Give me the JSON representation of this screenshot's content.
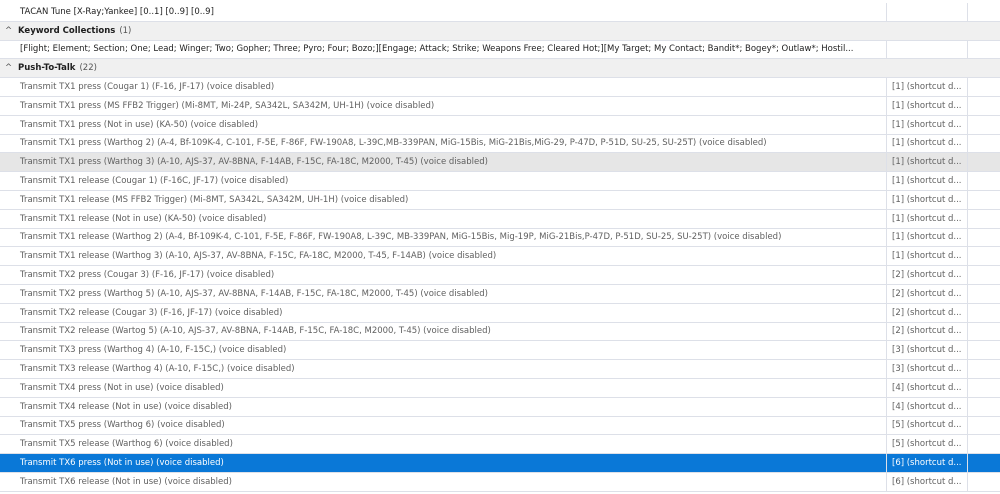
{
  "rows_top": [
    {
      "name": "TACAN Tune [X-Ray;Yankee] [0..1] [0..9] [0..9]",
      "arg": ""
    }
  ],
  "keyword_group": {
    "label": "Keyword Collections",
    "count": "(1)",
    "caret": "^"
  },
  "keyword_rows": [
    {
      "name": "[Flight; Element; Section; One; Lead; Winger; Two; Gopher; Three; Pyro; Four; Bozo;][Engage; Attack; Strike; Weapons Free; Cleared Hot;][My Target; My Contact; Bandit*; Bogey*; Outlaw*; Hostil...",
      "arg": ""
    }
  ],
  "ptt_group": {
    "label": "Push-To-Talk",
    "count": "(22)",
    "caret": "^"
  },
  "ptt_rows": [
    {
      "name": "Transmit TX1 press (Cougar 1) (F-16, JF-17)  (voice disabled)",
      "arg": "[1]  (shortcut d..."
    },
    {
      "name": "Transmit TX1 press (MS FFB2 Trigger) (Mi-8MT, Mi-24P, SA342L, SA342M, UH-1H)  (voice disabled)",
      "arg": "[1]  (shortcut d..."
    },
    {
      "name": "Transmit TX1 press (Not in use) (KA-50)  (voice disabled)",
      "arg": "[1]  (shortcut d..."
    },
    {
      "name": "Transmit TX1 press (Warthog 2) (A-4, Bf-109K-4, C-101, F-5E, F-86F, FW-190A8, L-39C,MB-339PAN, MiG-15Bis, MiG-21Bis,MiG-29, P-47D, P-51D, SU-25, SU-25T)  (voice disabled)",
      "arg": "[1]  (shortcut d..."
    },
    {
      "name": "Transmit TX1 press (Warthog 3) (A-10, AJS-37, AV-8BNA, F-14AB, F-15C, FA-18C, M2000, T-45)  (voice disabled)",
      "arg": "[1]  (shortcut d..."
    },
    {
      "name": "Transmit TX1 release (Cougar 1) (F-16C, JF-17)  (voice disabled)",
      "arg": "[1]  (shortcut d..."
    },
    {
      "name": "Transmit TX1 release (MS FFB2 Trigger) (Mi-8MT, SA342L, SA342M, UH-1H)  (voice disabled)",
      "arg": "[1]  (shortcut d..."
    },
    {
      "name": "Transmit TX1 release (Not in use) (KA-50)  (voice disabled)",
      "arg": "[1]  (shortcut d..."
    },
    {
      "name": "Transmit TX1 release (Warthog 2) (A-4, Bf-109K-4, C-101, F-5E, F-86F, FW-190A8, L-39C, MB-339PAN, MiG-15Bis, Mig-19P, MiG-21Bis,P-47D, P-51D, SU-25, SU-25T)  (voice disabled)",
      "arg": "[1]  (shortcut d..."
    },
    {
      "name": "Transmit TX1 release (Warthog 3) (A-10, AJS-37, AV-8BNA, F-15C, FA-18C, M2000, T-45, F-14AB)  (voice disabled)",
      "arg": "[1]  (shortcut d..."
    },
    {
      "name": "Transmit TX2 press (Cougar 3) (F-16, JF-17)  (voice disabled)",
      "arg": "[2]  (shortcut d..."
    },
    {
      "name": "Transmit TX2 press (Warthog 5) (A-10, AJS-37, AV-8BNA, F-14AB, F-15C, FA-18C, M2000, T-45)  (voice disabled)",
      "arg": "[2]  (shortcut d..."
    },
    {
      "name": "Transmit TX2 release (Cougar 3) (F-16, JF-17)  (voice disabled)",
      "arg": "[2]  (shortcut d..."
    },
    {
      "name": "Transmit TX2 release (Wartog 5) (A-10, AJS-37, AV-8BNA, F-14AB, F-15C, FA-18C, M2000, T-45)  (voice disabled)",
      "arg": "[2]  (shortcut d..."
    },
    {
      "name": "Transmit TX3 press (Warthog 4) (A-10, F-15C,)  (voice disabled)",
      "arg": "[3]  (shortcut d..."
    },
    {
      "name": "Transmit TX3 release (Warthog 4) (A-10, F-15C,)  (voice disabled)",
      "arg": "[3]  (shortcut d..."
    },
    {
      "name": "Transmit TX4 press (Not in use)  (voice disabled)",
      "arg": "[4]  (shortcut d..."
    },
    {
      "name": "Transmit TX4 release (Not in use)  (voice disabled)",
      "arg": "[4]  (shortcut d..."
    },
    {
      "name": "Transmit TX5 press (Warthog 6)  (voice disabled)",
      "arg": "[5]  (shortcut d..."
    },
    {
      "name": "Transmit TX5 release (Warthog 6)  (voice disabled)",
      "arg": "[5]  (shortcut d..."
    },
    {
      "name": "Transmit TX6 press (Not in use)  (voice disabled)",
      "arg": "[6]  (shortcut d..."
    },
    {
      "name": "Transmit TX6 release (Not in use)  (voice disabled)",
      "arg": "[6]  (shortcut d..."
    }
  ],
  "state": {
    "hover_row": "Transmit TX1 press (Warthog 3) (A-10, AJS-37, AV-8BNA, F-14AB, F-15C, FA-18C, M2000, T-45)  (voice disabled)",
    "selected_row": "Transmit TX6 press (Not in use)  (voice disabled)"
  },
  "colors": {
    "selected": "#0a78d7",
    "group_bg": "#f0f0f0",
    "hover": "#e6e6e6",
    "grid_line": "#dde0e8"
  }
}
